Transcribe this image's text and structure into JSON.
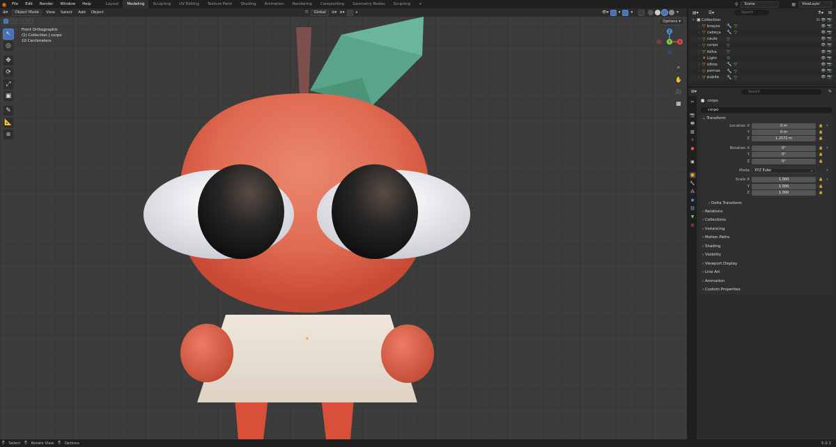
{
  "topbar": {
    "menus": [
      "File",
      "Edit",
      "Render",
      "Window",
      "Help"
    ],
    "workspaces": [
      "Layout",
      "Modeling",
      "Sculpting",
      "UV Editing",
      "Texture Paint",
      "Shading",
      "Animation",
      "Rendering",
      "Compositing",
      "Geometry Nodes",
      "Scripting"
    ],
    "active_workspace": "Modeling",
    "scene": "Scene",
    "view_layer": "ViewLayer"
  },
  "viewport": {
    "mode": "Object Mode",
    "menus": [
      "View",
      "Select",
      "Add",
      "Object"
    ],
    "orientation": "Global",
    "info_line1": "Front Orthographic",
    "info_line2": "(1) Collection | corpo",
    "info_line3": "10 Centimeters",
    "options_label": "Options",
    "gizmo_labels": {
      "x": "X",
      "y": "Y",
      "z": "Z"
    }
  },
  "outliner": {
    "search_placeholder": "Search",
    "collection": "Collection",
    "items": [
      {
        "name": "braços",
        "mod": true,
        "mesh": true
      },
      {
        "name": "cabeça",
        "mod": true,
        "mesh": true
      },
      {
        "name": "caule",
        "mod": false,
        "mesh": true
      },
      {
        "name": "corpo",
        "mod": false,
        "mesh": true
      },
      {
        "name": "folha",
        "mod": false,
        "mesh": true
      },
      {
        "name": "Light",
        "mod": false,
        "mesh": false
      },
      {
        "name": "olhos",
        "mod": true,
        "mesh": true
      },
      {
        "name": "pernas",
        "mod": true,
        "mesh": true
      },
      {
        "name": "pupila",
        "mod": true,
        "mesh": true
      }
    ]
  },
  "properties": {
    "search_placeholder": "Search",
    "object_name": "corpo",
    "object_field": "corpo",
    "transform": {
      "title": "Transform",
      "location_label": "Location X",
      "location": [
        "0 m",
        "0 m",
        "1.2572 m"
      ],
      "rotation_label": "Rotation X",
      "rotation": [
        "0°",
        "0°",
        "0°"
      ],
      "mode_label": "Mode",
      "mode": "XYZ Euler",
      "scale_label": "Scale X",
      "scale": [
        "1.000",
        "1.000",
        "1.000"
      ],
      "y": "Y",
      "z": "Z",
      "delta": "Delta Transform"
    },
    "panels": [
      "Relations",
      "Collections",
      "Instancing",
      "Motion Paths",
      "Shading",
      "Visibility",
      "Viewport Display",
      "Line Art",
      "Animation",
      "Custom Properties"
    ]
  },
  "statusbar": {
    "select": "Select",
    "rotate": "Rotate View",
    "options": "Options",
    "version": "5.0.1"
  },
  "colors": {
    "accent": "#4772b3",
    "apple": "#e0604a",
    "leaf": "#4f9f7f",
    "stem": "#7a4c4a",
    "skirt": "#e6ddd2",
    "eye_white": "#e6e6ec",
    "pupil": "#1e1e1e"
  }
}
